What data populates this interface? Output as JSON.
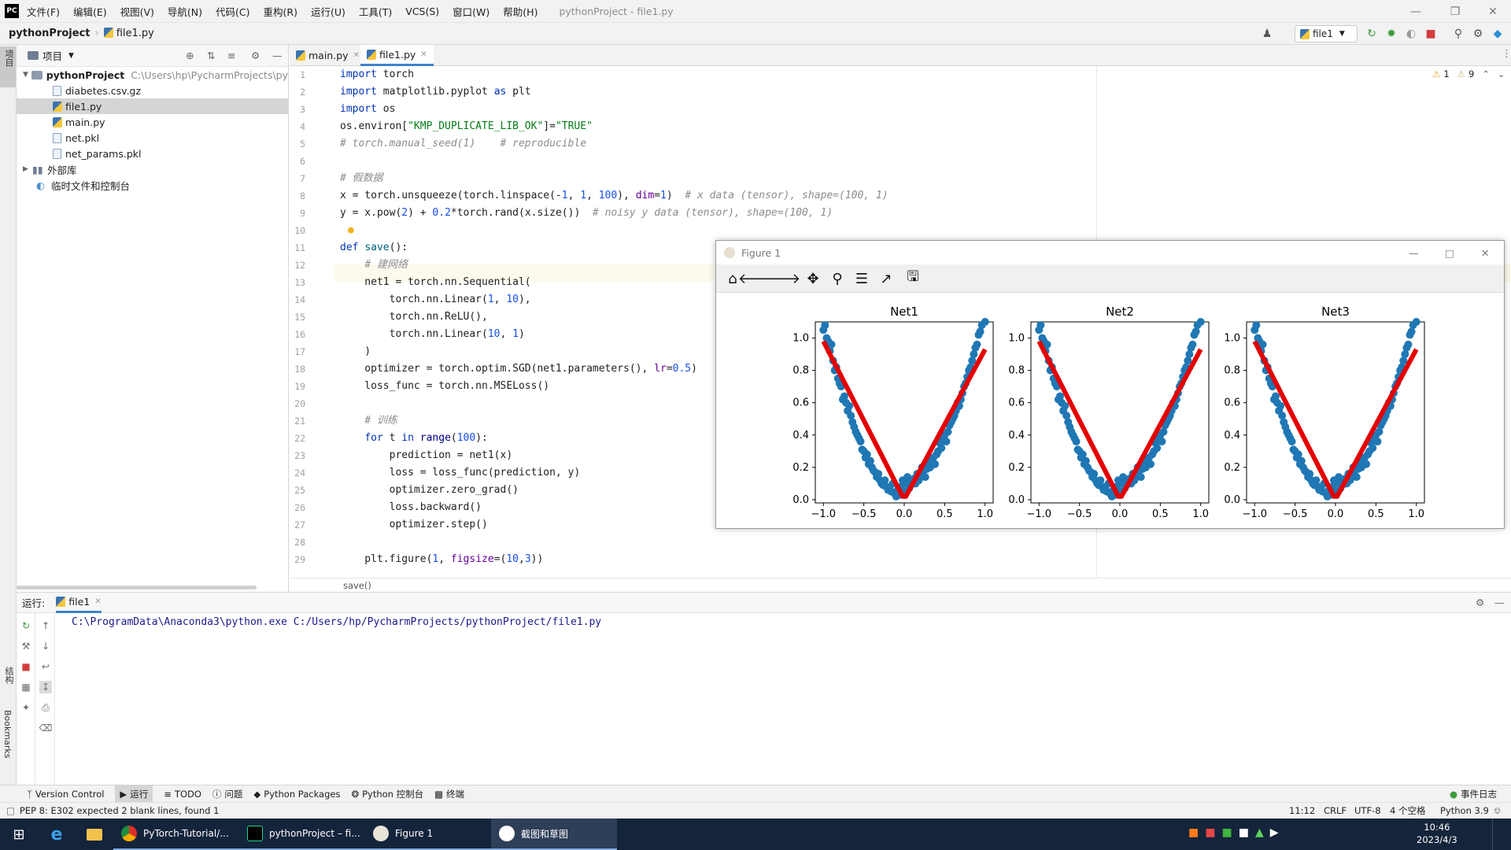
{
  "menubar": {
    "logo": "PC",
    "items": [
      "文件(F)",
      "编辑(E)",
      "视图(V)",
      "导航(N)",
      "代码(C)",
      "重构(R)",
      "运行(U)",
      "工具(T)",
      "VCS(S)",
      "窗口(W)",
      "帮助(H)"
    ],
    "window_title": "pythonProject - file1.py"
  },
  "navbar": {
    "project": "pythonProject",
    "file": "file1.py",
    "run_config": "file1"
  },
  "project_panel": {
    "title": "项目",
    "root_name": "pythonProject",
    "root_path": "C:\\Users\\hp\\PycharmProjects\\pytho",
    "files": [
      "diabetes.csv.gz",
      "file1.py",
      "main.py",
      "net.pkl",
      "net_params.pkl"
    ],
    "external_libs": "外部库",
    "scratches": "临时文件和控制台"
  },
  "side_tabs": {
    "project": "项目",
    "structure": "结构",
    "bookmarks": "Bookmarks"
  },
  "editor": {
    "tabs": [
      "main.py",
      "file1.py"
    ],
    "warnings": "1",
    "weak_warnings": "9",
    "line_numbers": [
      "1",
      "2",
      "3",
      "4",
      "5",
      "6",
      "7",
      "8",
      "9",
      "10",
      "11",
      "12",
      "13",
      "14",
      "15",
      "16",
      "17",
      "18",
      "19",
      "20",
      "21",
      "22",
      "23",
      "24",
      "25",
      "26",
      "27",
      "28",
      "29"
    ],
    "breadcrumb": "save()"
  },
  "figure_window": {
    "title": "Figure 1",
    "toolbar_icons": [
      "home-icon",
      "back-icon",
      "forward-icon",
      "pan-icon",
      "zoom-icon",
      "configure-subplots-icon",
      "edit-axis-icon",
      "save-icon"
    ]
  },
  "chart_data": [
    {
      "type": "scatter",
      "title": "Net1",
      "xlim": [
        -1.1,
        1.1
      ],
      "ylim": [
        -0.02,
        1.1
      ],
      "xticks": [
        "−1.0",
        "−0.5",
        "0.0",
        "0.5",
        "1.0"
      ],
      "yticks": [
        "0.0",
        "0.2",
        "0.4",
        "0.6",
        "0.8",
        "1.0"
      ],
      "series": [
        {
          "kind": "scatter",
          "color": "#1f77b4",
          "x": [
            -1.0,
            -0.98,
            -0.96,
            -0.94,
            -0.92,
            -0.9,
            -0.88,
            -0.86,
            -0.84,
            -0.82,
            -0.8,
            -0.78,
            -0.76,
            -0.74,
            -0.72,
            -0.7,
            -0.68,
            -0.66,
            -0.64,
            -0.62,
            -0.6,
            -0.58,
            -0.56,
            -0.54,
            -0.52,
            -0.5,
            -0.48,
            -0.46,
            -0.44,
            -0.42,
            -0.4,
            -0.38,
            -0.36,
            -0.34,
            -0.32,
            -0.3,
            -0.28,
            -0.26,
            -0.24,
            -0.22,
            -0.2,
            -0.18,
            -0.16,
            -0.14,
            -0.12,
            -0.1,
            -0.08,
            -0.06,
            -0.04,
            -0.02,
            0.0,
            0.02,
            0.04,
            0.06,
            0.08,
            0.1,
            0.12,
            0.14,
            0.16,
            0.18,
            0.2,
            0.22,
            0.24,
            0.26,
            0.28,
            0.3,
            0.32,
            0.34,
            0.36,
            0.38,
            0.4,
            0.42,
            0.44,
            0.46,
            0.48,
            0.5,
            0.52,
            0.54,
            0.56,
            0.58,
            0.6,
            0.62,
            0.64,
            0.66,
            0.68,
            0.7,
            0.72,
            0.74,
            0.76,
            0.78,
            0.8,
            0.82,
            0.84,
            0.86,
            0.88,
            0.9,
            0.92,
            0.94,
            0.96,
            1.0
          ],
          "y": [
            1.05,
            1.08,
            1.0,
            0.98,
            0.92,
            0.96,
            0.86,
            0.8,
            0.82,
            0.75,
            0.72,
            0.7,
            0.62,
            0.64,
            0.6,
            0.55,
            0.58,
            0.52,
            0.48,
            0.45,
            0.42,
            0.4,
            0.38,
            0.36,
            0.31,
            0.3,
            0.26,
            0.28,
            0.22,
            0.24,
            0.2,
            0.18,
            0.17,
            0.14,
            0.16,
            0.12,
            0.1,
            0.09,
            0.12,
            0.08,
            0.06,
            0.08,
            0.05,
            0.1,
            0.04,
            0.02,
            0.06,
            0.03,
            0.08,
            0.12,
            0.05,
            0.1,
            0.14,
            0.07,
            0.09,
            0.12,
            0.13,
            0.1,
            0.16,
            0.12,
            0.15,
            0.2,
            0.18,
            0.14,
            0.19,
            0.22,
            0.2,
            0.25,
            0.26,
            0.22,
            0.28,
            0.3,
            0.35,
            0.32,
            0.38,
            0.4,
            0.36,
            0.42,
            0.46,
            0.48,
            0.5,
            0.52,
            0.55,
            0.6,
            0.58,
            0.62,
            0.66,
            0.7,
            0.72,
            0.76,
            0.8,
            0.82,
            0.86,
            0.9,
            0.94,
            0.96,
            1.02,
            1.04,
            1.08,
            1.1
          ]
        },
        {
          "kind": "line",
          "color": "#e50000",
          "x": [
            -1.0,
            -0.02,
            0.0,
            0.02,
            1.0
          ],
          "y": [
            0.98,
            0.02,
            0.02,
            0.02,
            0.93
          ]
        }
      ]
    },
    {
      "type": "scatter",
      "title": "Net2",
      "xlim": [
        -1.1,
        1.1
      ],
      "ylim": [
        -0.02,
        1.1
      ],
      "xticks": [
        "−1.0",
        "−0.5",
        "0.0",
        "0.5",
        "1.0"
      ],
      "yticks": [
        "0.0",
        "0.2",
        "0.4",
        "0.6",
        "0.8",
        "1.0"
      ],
      "series": [
        {
          "kind": "scatter",
          "color": "#1f77b4",
          "x": [
            -1.0,
            -0.98,
            -0.96,
            -0.94,
            -0.92,
            -0.9,
            -0.88,
            -0.86,
            -0.84,
            -0.82,
            -0.8,
            -0.78,
            -0.76,
            -0.74,
            -0.72,
            -0.7,
            -0.68,
            -0.66,
            -0.64,
            -0.62,
            -0.6,
            -0.58,
            -0.56,
            -0.54,
            -0.52,
            -0.5,
            -0.48,
            -0.46,
            -0.44,
            -0.42,
            -0.4,
            -0.38,
            -0.36,
            -0.34,
            -0.32,
            -0.3,
            -0.28,
            -0.26,
            -0.24,
            -0.22,
            -0.2,
            -0.18,
            -0.16,
            -0.14,
            -0.12,
            -0.1,
            -0.08,
            -0.06,
            -0.04,
            -0.02,
            0.0,
            0.02,
            0.04,
            0.06,
            0.08,
            0.1,
            0.12,
            0.14,
            0.16,
            0.18,
            0.2,
            0.22,
            0.24,
            0.26,
            0.28,
            0.3,
            0.32,
            0.34,
            0.36,
            0.38,
            0.4,
            0.42,
            0.44,
            0.46,
            0.48,
            0.5,
            0.52,
            0.54,
            0.56,
            0.58,
            0.6,
            0.62,
            0.64,
            0.66,
            0.68,
            0.7,
            0.72,
            0.74,
            0.76,
            0.78,
            0.8,
            0.82,
            0.84,
            0.86,
            0.88,
            0.9,
            0.92,
            0.94,
            0.96,
            1.0
          ],
          "y": [
            1.05,
            1.08,
            1.0,
            0.98,
            0.92,
            0.96,
            0.86,
            0.8,
            0.82,
            0.75,
            0.72,
            0.7,
            0.62,
            0.64,
            0.6,
            0.55,
            0.58,
            0.52,
            0.48,
            0.45,
            0.42,
            0.4,
            0.38,
            0.36,
            0.31,
            0.3,
            0.26,
            0.28,
            0.22,
            0.24,
            0.2,
            0.18,
            0.17,
            0.14,
            0.16,
            0.12,
            0.1,
            0.09,
            0.12,
            0.08,
            0.06,
            0.08,
            0.05,
            0.1,
            0.04,
            0.02,
            0.06,
            0.03,
            0.08,
            0.12,
            0.05,
            0.1,
            0.14,
            0.07,
            0.09,
            0.12,
            0.13,
            0.1,
            0.16,
            0.12,
            0.15,
            0.2,
            0.18,
            0.14,
            0.19,
            0.22,
            0.2,
            0.25,
            0.26,
            0.22,
            0.28,
            0.3,
            0.35,
            0.32,
            0.38,
            0.4,
            0.36,
            0.42,
            0.46,
            0.48,
            0.5,
            0.52,
            0.55,
            0.6,
            0.58,
            0.62,
            0.66,
            0.7,
            0.72,
            0.76,
            0.8,
            0.82,
            0.86,
            0.9,
            0.94,
            0.96,
            1.02,
            1.04,
            1.08,
            1.1
          ]
        },
        {
          "kind": "line",
          "color": "#e50000",
          "x": [
            -1.0,
            -0.02,
            0.0,
            0.02,
            1.0
          ],
          "y": [
            0.98,
            0.02,
            0.02,
            0.02,
            0.93
          ]
        }
      ]
    },
    {
      "type": "scatter",
      "title": "Net3",
      "xlim": [
        -1.1,
        1.1
      ],
      "ylim": [
        -0.02,
        1.1
      ],
      "xticks": [
        "−1.0",
        "−0.5",
        "0.0",
        "0.5",
        "1.0"
      ],
      "yticks": [
        "0.0",
        "0.2",
        "0.4",
        "0.6",
        "0.8",
        "1.0"
      ],
      "series": [
        {
          "kind": "scatter",
          "color": "#1f77b4",
          "x": [
            -1.0,
            -0.98,
            -0.96,
            -0.94,
            -0.92,
            -0.9,
            -0.88,
            -0.86,
            -0.84,
            -0.82,
            -0.8,
            -0.78,
            -0.76,
            -0.74,
            -0.72,
            -0.7,
            -0.68,
            -0.66,
            -0.64,
            -0.62,
            -0.6,
            -0.58,
            -0.56,
            -0.54,
            -0.52,
            -0.5,
            -0.48,
            -0.46,
            -0.44,
            -0.42,
            -0.4,
            -0.38,
            -0.36,
            -0.34,
            -0.32,
            -0.3,
            -0.28,
            -0.26,
            -0.24,
            -0.22,
            -0.2,
            -0.18,
            -0.16,
            -0.14,
            -0.12,
            -0.1,
            -0.08,
            -0.06,
            -0.04,
            -0.02,
            0.0,
            0.02,
            0.04,
            0.06,
            0.08,
            0.1,
            0.12,
            0.14,
            0.16,
            0.18,
            0.2,
            0.22,
            0.24,
            0.26,
            0.28,
            0.3,
            0.32,
            0.34,
            0.36,
            0.38,
            0.4,
            0.42,
            0.44,
            0.46,
            0.48,
            0.5,
            0.52,
            0.54,
            0.56,
            0.58,
            0.6,
            0.62,
            0.64,
            0.66,
            0.68,
            0.7,
            0.72,
            0.74,
            0.76,
            0.78,
            0.8,
            0.82,
            0.84,
            0.86,
            0.88,
            0.9,
            0.92,
            0.94,
            0.96,
            1.0
          ],
          "y": [
            1.05,
            1.08,
            1.0,
            0.98,
            0.92,
            0.96,
            0.86,
            0.8,
            0.82,
            0.75,
            0.72,
            0.7,
            0.62,
            0.64,
            0.6,
            0.55,
            0.58,
            0.52,
            0.48,
            0.45,
            0.42,
            0.4,
            0.38,
            0.36,
            0.31,
            0.3,
            0.26,
            0.28,
            0.22,
            0.24,
            0.2,
            0.18,
            0.17,
            0.14,
            0.16,
            0.12,
            0.1,
            0.09,
            0.12,
            0.08,
            0.06,
            0.08,
            0.05,
            0.1,
            0.04,
            0.02,
            0.06,
            0.03,
            0.08,
            0.12,
            0.05,
            0.1,
            0.14,
            0.07,
            0.09,
            0.12,
            0.13,
            0.1,
            0.16,
            0.12,
            0.15,
            0.2,
            0.18,
            0.14,
            0.19,
            0.22,
            0.2,
            0.25,
            0.26,
            0.22,
            0.28,
            0.3,
            0.35,
            0.32,
            0.38,
            0.4,
            0.36,
            0.42,
            0.46,
            0.48,
            0.5,
            0.52,
            0.55,
            0.6,
            0.58,
            0.62,
            0.66,
            0.7,
            0.72,
            0.76,
            0.8,
            0.82,
            0.86,
            0.9,
            0.94,
            0.96,
            1.02,
            1.04,
            1.08,
            1.1
          ]
        },
        {
          "kind": "line",
          "color": "#e50000",
          "x": [
            -1.0,
            -0.02,
            0.0,
            0.02,
            1.0
          ],
          "y": [
            0.98,
            0.02,
            0.02,
            0.02,
            0.93
          ]
        }
      ]
    }
  ],
  "run_panel": {
    "label": "运行:",
    "tab": "file1",
    "console_line": "C:\\ProgramData\\Anaconda3\\python.exe C:/Users/hp/PycharmProjects/pythonProject/file1.py"
  },
  "bottom_tabs": [
    "Version Control",
    "运行",
    "TODO",
    "问题",
    "Python Packages",
    "Python 控制台",
    "终端"
  ],
  "event_log": "事件日志",
  "status": {
    "message": "PEP 8: E302 expected 2 blank lines, found 1",
    "position": "11:12",
    "line_sep": "CRLF",
    "encoding": "UTF-8",
    "indent": "4 个空格",
    "interpreter": "Python 3.9"
  },
  "taskbar": {
    "apps": [
      "PyTorch-Tutorial/...",
      "pythonProject – fi...",
      "Figure 1",
      "截图和草图"
    ],
    "time": "10:46",
    "date": "2023/4/3"
  }
}
